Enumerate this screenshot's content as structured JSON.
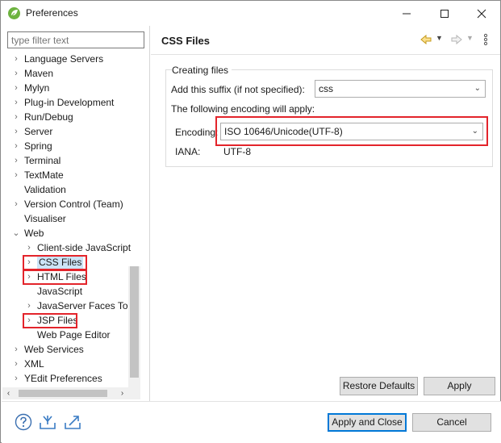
{
  "window": {
    "title": "Preferences",
    "controls": {
      "minimize": "—",
      "maximize": "☐",
      "close": "✕"
    }
  },
  "sidebar": {
    "filter_placeholder": "type filter text",
    "items": [
      {
        "label": "Language Servers",
        "expandable": true
      },
      {
        "label": "Maven",
        "expandable": true
      },
      {
        "label": "Mylyn",
        "expandable": true
      },
      {
        "label": "Plug-in Development",
        "expandable": true
      },
      {
        "label": "Run/Debug",
        "expandable": true
      },
      {
        "label": "Server",
        "expandable": true
      },
      {
        "label": "Spring",
        "expandable": true
      },
      {
        "label": "Terminal",
        "expandable": true
      },
      {
        "label": "TextMate",
        "expandable": true
      },
      {
        "label": "Validation",
        "expandable": false
      },
      {
        "label": "Version Control (Team)",
        "expandable": true
      },
      {
        "label": "Visualiser",
        "expandable": false
      },
      {
        "label": "Web",
        "expandable": true,
        "expanded": true
      },
      {
        "label": "Client-side JavaScript",
        "expandable": true,
        "child": true
      },
      {
        "label": "CSS Files",
        "expandable": true,
        "child": true,
        "selected": true
      },
      {
        "label": "HTML Files",
        "expandable": true,
        "child": true
      },
      {
        "label": "JavaScript",
        "expandable": false,
        "child": true
      },
      {
        "label": "JavaServer Faces Tools",
        "expandable": true,
        "child": true
      },
      {
        "label": "JSP Files",
        "expandable": true,
        "child": true
      },
      {
        "label": "Web Page Editor",
        "expandable": false,
        "child": true
      },
      {
        "label": "Web Services",
        "expandable": true
      },
      {
        "label": "XML",
        "expandable": true
      },
      {
        "label": "YEdit Preferences",
        "expandable": true
      }
    ]
  },
  "page": {
    "title": "CSS Files",
    "group_title": "Creating files",
    "suffix_label": "Add this suffix (if not specified):",
    "suffix_value": "css",
    "encoding_note": "The following encoding will apply:",
    "encoding_label": "Encoding:",
    "encoding_value": "ISO 10646/Unicode(UTF-8)",
    "iana_label": "IANA:",
    "iana_value": "UTF-8",
    "restore_defaults": "Restore Defaults",
    "apply": "Apply"
  },
  "footer": {
    "apply_and_close": "Apply and Close",
    "cancel": "Cancel"
  },
  "colors": {
    "highlight_box": "#e3242b",
    "selection": "#cce4f7",
    "primary_border": "#0078d7"
  }
}
